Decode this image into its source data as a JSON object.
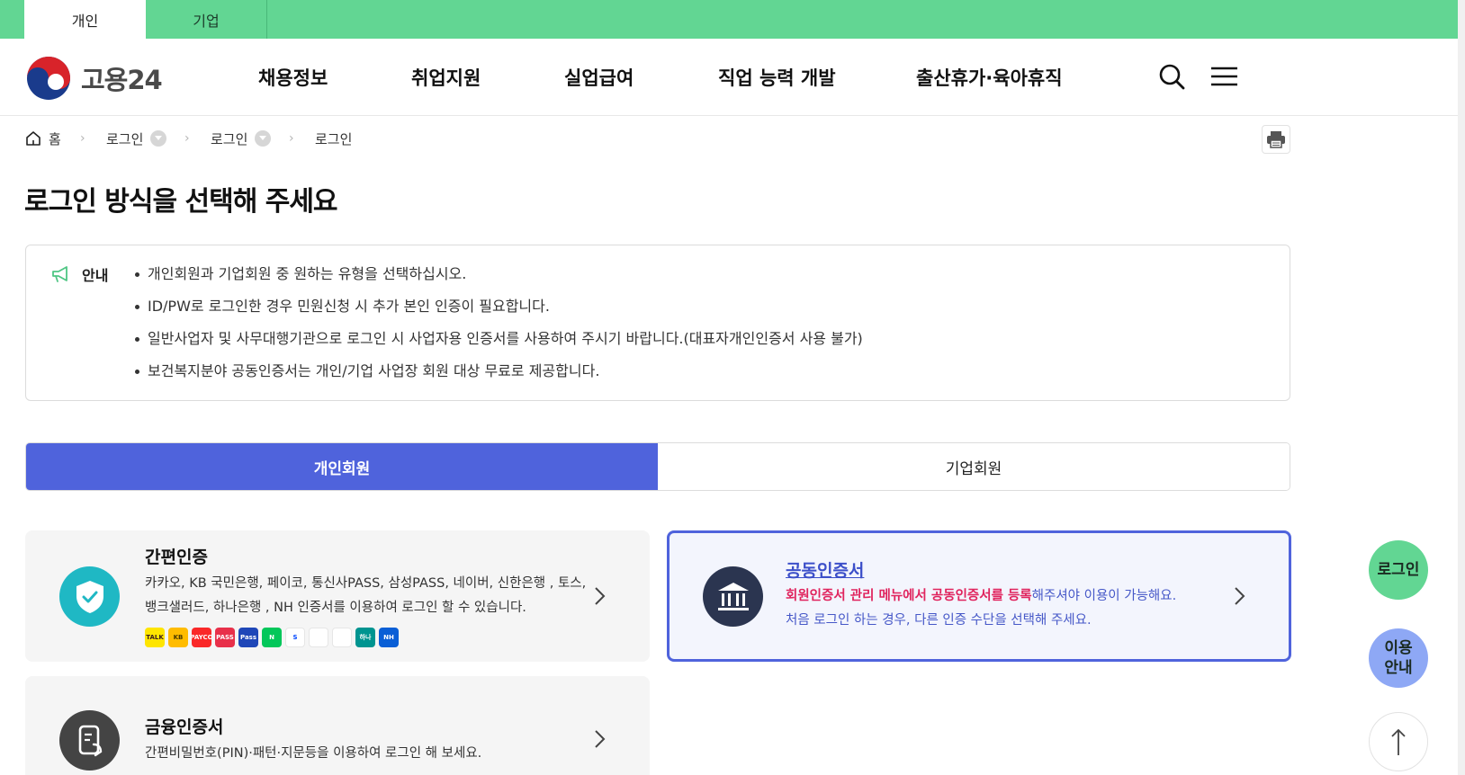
{
  "top_tabs": [
    {
      "label": "개인",
      "active": true
    },
    {
      "label": "기업",
      "active": false
    }
  ],
  "header": {
    "logo_text": "고용24",
    "nav": [
      "채용정보",
      "취업지원",
      "실업급여",
      "직업 능력 개발",
      "출산휴가·육아휴직"
    ],
    "icons": [
      "search-icon",
      "menu-icon"
    ]
  },
  "breadcrumb": {
    "home": "홈",
    "items": [
      "로그인",
      "로그인",
      "로그인"
    ]
  },
  "page_title": "로그인 방식을 선택해 주세요",
  "notice": {
    "label": "안내",
    "items": [
      "개인회원과 기업회원 중 원하는 유형을 선택하십시오.",
      "ID/PW로 로그인한 경우 민원신청 시 추가 본인 인증이 필요합니다.",
      "일반사업자 및 사무대행기관으로 로그인 시 사업자용 인증서를 사용하여 주시기 바랍니다.(대표자개인인증서 사용 불가)",
      "보건복지분야 공동인증서는 개인/기업 사업장 회원 대상 무료로 제공합니다."
    ]
  },
  "member_tabs": [
    {
      "label": "개인회원",
      "active": true
    },
    {
      "label": "기업회원",
      "active": false
    }
  ],
  "cards": {
    "simple": {
      "title": "간편인증",
      "desc_line1": "카카오, KB 국민은행, 페이코, 통신사PASS, 삼성PASS, 네이버, 신한은행 , 토스,",
      "desc_line2": "뱅크샐러드, 하나은행 , NH 인증서를 이용하여 로그인 할 수 있습니다.",
      "brands": [
        {
          "name": "kakao-talk-logo",
          "text": "TALK",
          "color": "#fee500",
          "fg": "#3a1d1d"
        },
        {
          "name": "kb-logo",
          "text": "KB",
          "color": "#ffbc00",
          "fg": "#4a3a00"
        },
        {
          "name": "payco-logo",
          "text": "PAYCO",
          "color": "#fa2828",
          "fg": "#ffffff"
        },
        {
          "name": "pass-logo",
          "text": "PASS",
          "color": "#e8304a",
          "fg": "#ffffff"
        },
        {
          "name": "samsung-pass-logo",
          "text": "Pass",
          "color": "#1f47b8",
          "fg": "#ffffff"
        },
        {
          "name": "naver-logo",
          "text": "N",
          "color": "#03c75a",
          "fg": "#ffffff"
        },
        {
          "name": "shinhan-logo",
          "text": "S",
          "color": "#ffffff",
          "fg": "#0046ff"
        },
        {
          "name": "toss-logo",
          "text": "",
          "color": "#ffffff",
          "fg": "#0064ff"
        },
        {
          "name": "banksalad-logo",
          "text": "",
          "color": "#ffffff",
          "fg": "#00c06a"
        },
        {
          "name": "hana-logo",
          "text": "하나",
          "color": "#009490",
          "fg": "#ffffff"
        },
        {
          "name": "nh-logo",
          "text": "NH",
          "color": "#0a5fd6",
          "fg": "#ffffff"
        }
      ]
    },
    "financial": {
      "title": "금융인증서",
      "desc": "간편비밀번호(PIN)·패턴·지문등을 이용하여 로그인 해 보세요."
    },
    "joint": {
      "title": "공동인증서",
      "desc_red1": "회원인증서 관리 메뉴에서 공동인증서를 등록",
      "desc_blue1": "해주셔야 이용이 가능해요.",
      "desc_blue2": "처음 로그인 하는 경우, 다른 인증 수단을 선택해 주세요."
    }
  },
  "floating": {
    "login": "로그인",
    "guide_line1": "이용",
    "guide_line2": "안내",
    "top_icon": "arrow-up-icon"
  },
  "colors": {
    "topbar": "#62d693",
    "primary": "#4f63dc",
    "accent_red": "#e0245e",
    "teal_icon": "#1fb8c4",
    "navy_icon": "#2b3550",
    "dark_icon": "#444444"
  }
}
